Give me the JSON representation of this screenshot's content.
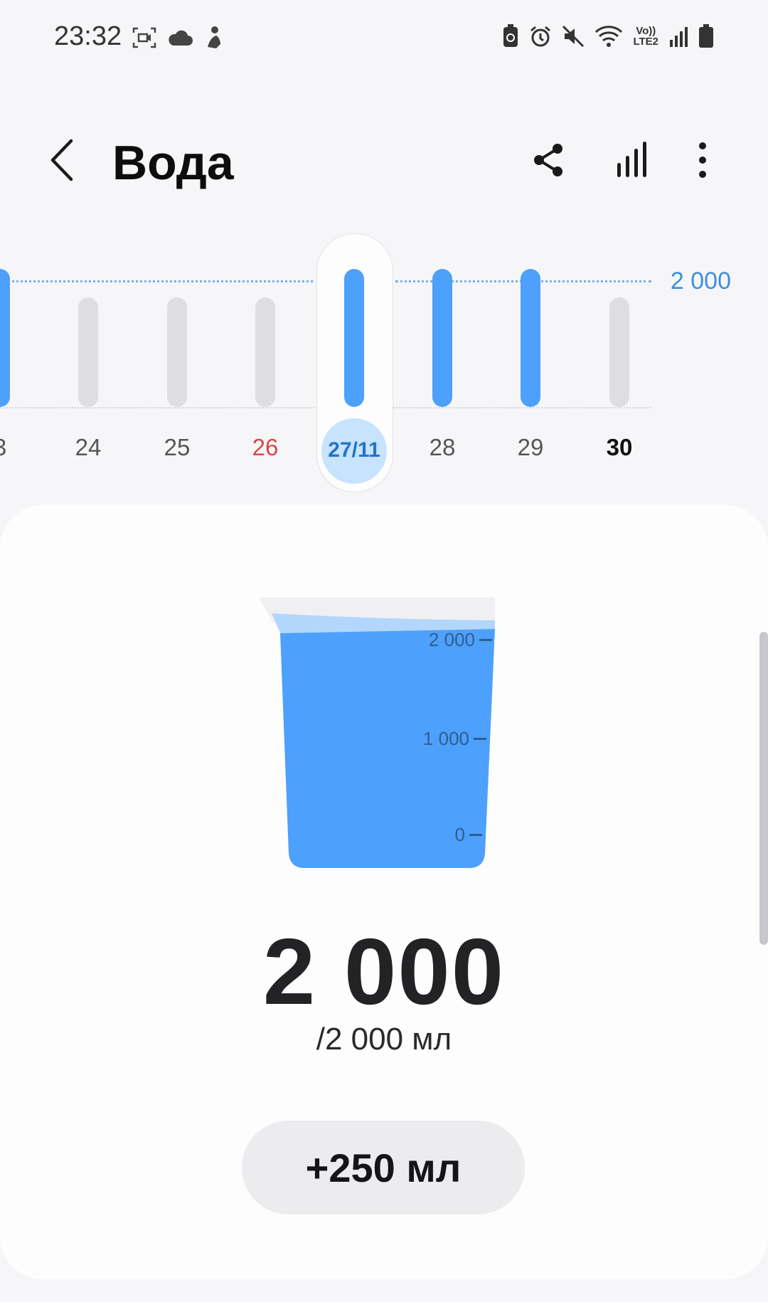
{
  "status_bar": {
    "time": "23:32",
    "left_icons": [
      "screen-record-icon",
      "cloud-icon",
      "fitness-person-icon"
    ],
    "right_icons": [
      "battery-saver-icon",
      "alarm-icon",
      "mute-icon",
      "wifi-icon",
      "volte-icon",
      "signal-icon",
      "battery-icon"
    ],
    "volte_top": "Vo))",
    "volte_bottom": "LTE2"
  },
  "header": {
    "title": "Вода",
    "actions": [
      "share-icon",
      "stats-icon",
      "more-icon"
    ]
  },
  "week_chart": {
    "goal_label": "2 000",
    "goal": 2000,
    "days": [
      {
        "label": "3",
        "value": 2000,
        "filled": true
      },
      {
        "label": "24",
        "value": 0,
        "filled": false
      },
      {
        "label": "25",
        "value": 0,
        "filled": false
      },
      {
        "label": "26",
        "value": 0,
        "filled": false,
        "sunday": true
      },
      {
        "label": "27/11",
        "value": 2000,
        "filled": true,
        "selected": true
      },
      {
        "label": "28",
        "value": 2000,
        "filled": true
      },
      {
        "label": "29",
        "value": 2000,
        "filled": true
      },
      {
        "label": "30",
        "value": 0,
        "filled": false,
        "today": true
      }
    ]
  },
  "glass": {
    "scale_labels": [
      "2 000",
      "1 000",
      "0"
    ],
    "fill_fraction": 1.0,
    "water_color": "#4da0fb"
  },
  "summary": {
    "amount": "2 000",
    "goal_text": "/2 000 мл"
  },
  "add_button": {
    "label": "+250 мл"
  },
  "colors": {
    "accent": "#4da0fb",
    "goal_text": "#3d8fde",
    "sunday": "#d24b45",
    "selected_circle": "#c7e3fd"
  }
}
